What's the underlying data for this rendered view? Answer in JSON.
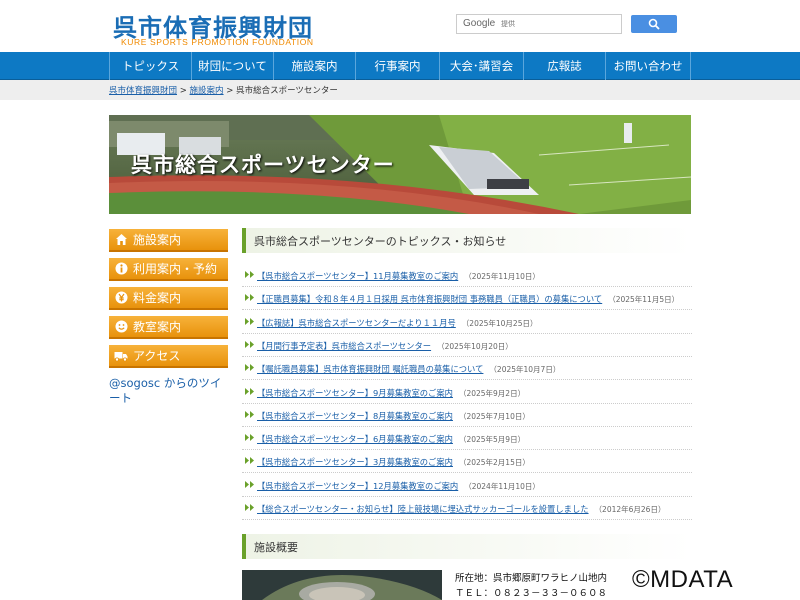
{
  "header": {
    "logo_title": "呉市体育振興財団",
    "logo_subtitle": "KURE SPORTS PROMOTION FOUNDATION",
    "search_brand": "Google",
    "search_placeholder": "提供"
  },
  "nav": {
    "items": [
      {
        "label": "トピックス"
      },
      {
        "label": "財団について"
      },
      {
        "label": "施設案内"
      },
      {
        "label": "行事案内"
      },
      {
        "label": "大会･講習会"
      },
      {
        "label": "広報誌"
      },
      {
        "label": "お問い合わせ"
      }
    ]
  },
  "breadcrumb": {
    "home": "呉市体育振興財団",
    "sep1": " > ",
    "facilities": "施設案内",
    "sep2": " > ",
    "current": "呉市総合スポーツセンター"
  },
  "hero": {
    "title": "呉市総合スポーツセンター"
  },
  "sidebar": {
    "buttons": [
      {
        "label": "施設案内",
        "icon": "home-icon"
      },
      {
        "label": "利用案内・予約",
        "icon": "info-icon"
      },
      {
        "label": "料金案内",
        "icon": "yen-icon"
      },
      {
        "label": "教室案内",
        "icon": "smile-icon"
      },
      {
        "label": "アクセス",
        "icon": "truck-icon"
      }
    ],
    "twitter_link": "@sogosc からのツイート"
  },
  "topics": {
    "heading": "呉市総合スポーツセンターのトピックス・お知らせ",
    "items": [
      {
        "text": "【呉市総合スポーツセンター】11月募集教室のご案内",
        "date": "（2025年11月10日）"
      },
      {
        "text": "【正職員募集】令和８年４月１日採用 呉市体育振興財団 事務職員（正職員）の募集について",
        "date": "（2025年11月5日）"
      },
      {
        "text": "【広報誌】呉市総合スポーツセンターだより１１月号",
        "date": "（2025年10月25日）"
      },
      {
        "text": "【月間行事予定表】呉市総合スポーツセンター",
        "date": "（2025年10月20日）"
      },
      {
        "text": "【嘱託職員募集】呉市体育振興財団 嘱託職員の募集について",
        "date": "（2025年10月7日）"
      },
      {
        "text": "【呉市総合スポーツセンター】9月募集教室のご案内",
        "date": "（2025年9月2日）"
      },
      {
        "text": "【呉市総合スポーツセンター】8月募集教室のご案内",
        "date": "（2025年7月10日）"
      },
      {
        "text": "【呉市総合スポーツセンター】6月募集教室のご案内",
        "date": "（2025年5月9日）"
      },
      {
        "text": "【呉市総合スポーツセンター】3月募集教室のご案内",
        "date": "（2025年2月15日）"
      },
      {
        "text": "【呉市総合スポーツセンター】12月募集教室のご案内",
        "date": "（2024年11月10日）"
      },
      {
        "text": "【総合スポーツセンター・お知らせ】陸上競技場に埋込式サッカーゴールを設置しました",
        "date": "（2012年6月26日）"
      }
    ]
  },
  "facility": {
    "heading": "施設概要",
    "address": "所在地：呉市郷原町ワラヒノ山地内",
    "tel": "ＴＥＬ：０８２３－３３－０６０８"
  },
  "watermark": "©MDATA",
  "colors": {
    "brand_blue": "#0d79c4",
    "accent_orange": "#f08a00",
    "link_blue": "#1a5fa8",
    "section_green": "#6aa12a"
  }
}
